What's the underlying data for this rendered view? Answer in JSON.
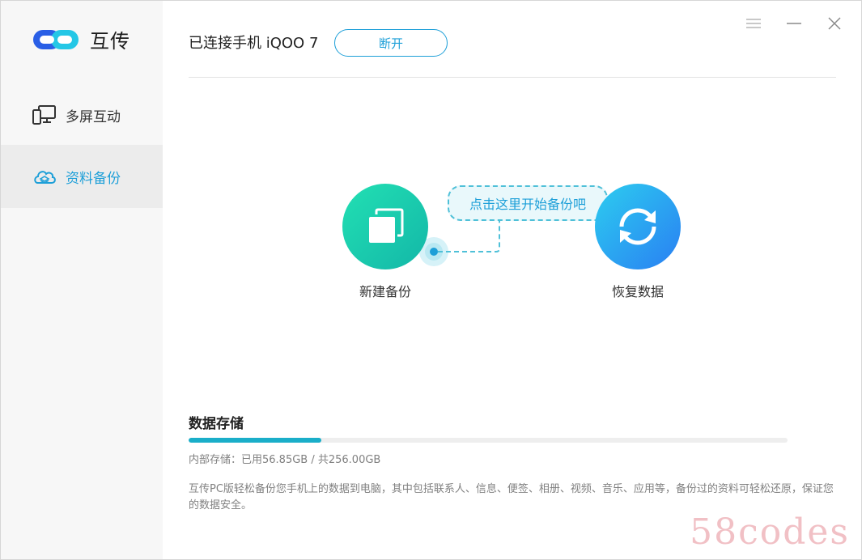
{
  "app": {
    "name": "互传"
  },
  "sidebar": {
    "items": [
      {
        "label": "多屏互动",
        "icon": "multi-screen-icon",
        "active": false
      },
      {
        "label": "资料备份",
        "icon": "cloud-backup-icon",
        "active": true
      }
    ]
  },
  "header": {
    "connection_text": "已连接手机 iQOO 7",
    "disconnect_label": "断开"
  },
  "actions": {
    "new_backup_label": "新建备份",
    "restore_label": "恢复数据",
    "hint_text": "点击这里开始备份吧"
  },
  "storage": {
    "title": "数据存储",
    "info": "内部存储：已用56.85GB / 共256.00GB",
    "used_gb": 56.85,
    "total_gb": 256.0
  },
  "description": "互传PC版轻松备份您手机上的数据到电脑，其中包括联系人、信息、便签、相册、视频、音乐、应用等，备份过的资料可轻松还原，保证您的数据安全。",
  "watermark": "58codes",
  "colors": {
    "accent": "#1d9fd8",
    "teal": "#13b7a8",
    "progress": "#1aaec9"
  },
  "window_controls": [
    "menu-icon",
    "minimize-icon",
    "close-icon"
  ]
}
